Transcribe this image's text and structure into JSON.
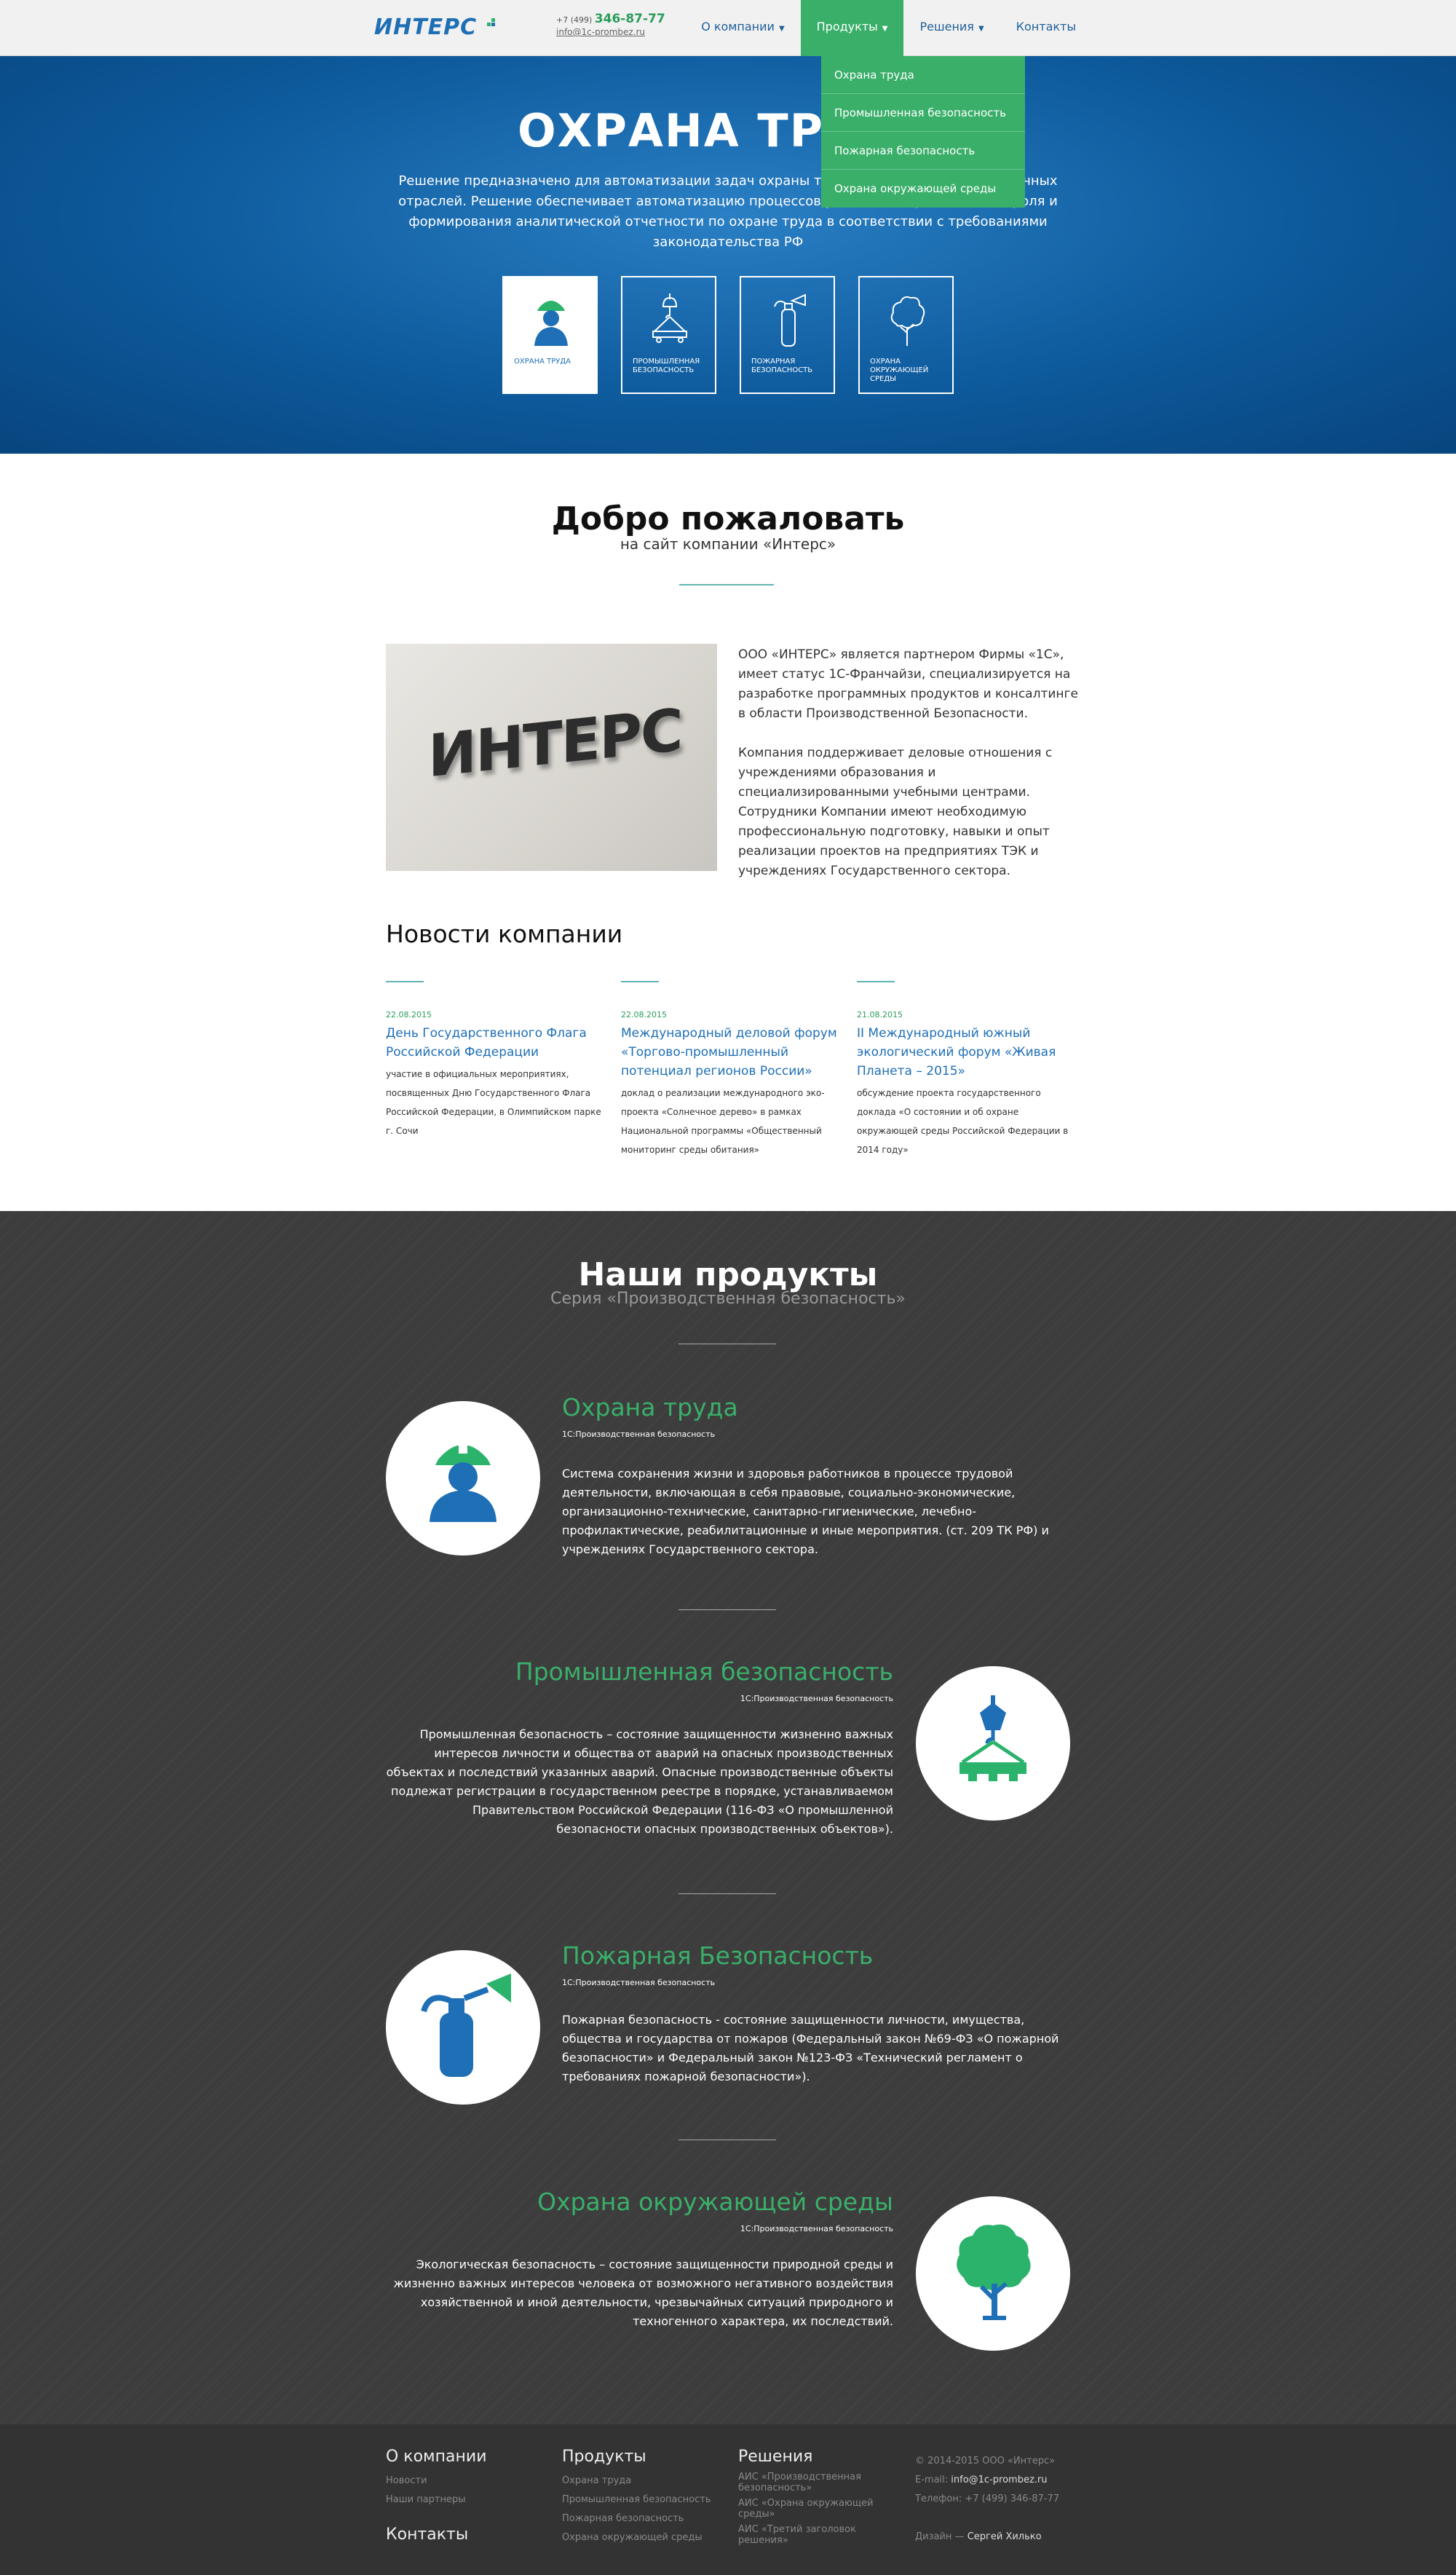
{
  "header": {
    "logo": "ИНТЕРС",
    "phone_prefix": "+7 (499)",
    "phone_number": "346-87-77",
    "email": "info@1c-prombez.ru",
    "nav": [
      "О компании",
      "Продукты",
      "Решения",
      "Контакты"
    ],
    "dropdown": [
      "Охрана труда",
      "Промышленная безопасность",
      "Пожарная безопасность",
      "Охрана окружающей среды"
    ]
  },
  "hero": {
    "title": "ОХРАНА ТРУДА",
    "description": "Решение предназначено для автоматизации задач охраны труда на предприятиях различных отраслей. Решение обеспечивает автоматизацию процессов учета, планирования, контроля и формирования аналитической отчетности по охране труда в соответствии с требованиями законодательства РФ",
    "tiles": [
      "Охрана труда",
      "Промышленная безопасность",
      "Пожарная безопасность",
      "Охрана окружающей среды"
    ]
  },
  "welcome": {
    "title": "Добро пожаловать",
    "subtitle": "на сайт компании «Интерс»",
    "sign": "ИНТЕРС",
    "p1": "ООО «ИНТЕРС» является партнером Фирмы «1С», имеет статус 1С-Франчайзи, специализируется на разработке программных продуктов и консалтинге в области Производственной Безопасности.",
    "p2": "Компания поддерживает деловые отношения с учреждениями образования и специализированными учебными центрами. Сотрудники Компании имеют необходимую профессиональную подготовку, навыки и опыт реализации проектов на предприятиях ТЭК и учреждениях Государственного сектора."
  },
  "news": {
    "title": "Новости компании",
    "items": [
      {
        "date": "22.08.2015",
        "title": "День Государственного Флага Российской Федерации",
        "text": "участие в официальных мероприятиях, посвященных Дню Государственного Флага Российской Федерации, в Олимпийском парке г. Сочи"
      },
      {
        "date": "22.08.2015",
        "title": "Международный деловой форум «Торгово-промышленный потенциал регионов России»",
        "text": "доклад о реализации международного эко-проекта «Солнечное дерево» в рамках Национальной программы «Общественный мониторинг среды обитания»"
      },
      {
        "date": "21.08.2015",
        "title": "II Международный южный экологический форум «Живая Планета – 2015»",
        "text": "обсуждение проекта государственного доклада «О состоянии и об охране окружающей среды Российской Федерации в 2014 году»"
      }
    ]
  },
  "products": {
    "title": "Наши продукты",
    "subtitle": "Серия «Производственная безопасность»",
    "tag": "1С:Производственная безопасность",
    "items": [
      {
        "title": "Охрана труда",
        "text": "Система сохранения жизни и здоровья работников в процессе трудовой деятельности, включающая в себя правовые, социально-экономические, организационно-технические, санитарно-гигиенические, лечебно-профилактические, реабилитационные и иные мероприятия. (ст. 209 ТК РФ) и учреждениях Государственного сектора."
      },
      {
        "title": "Промышленная безопасность",
        "text": "Промышленная безопасность – состояние защищенности жизненно важных интересов личности и общества от аварий на опасных производственных объектах и последствий указанных аварий. Опасные производственные объекты подлежат регистрации в государственном реестре в порядке, устанавливаемом Правительством Российской Федерации (116-ФЗ «О промышленной безопасности опасных производственных объектов»)."
      },
      {
        "title": "Пожарная Безопасность",
        "text": "Пожарная безопасность - состояние защищенности личности, имущества, общества и государства от пожаров (Федеральный закон №69-ФЗ «О пожарной безопасности» и Федеральный закон №123-ФЗ «Технический регламент о требованиях пожарной безопасности»)."
      },
      {
        "title": "Охрана окружающей среды",
        "text": "Экологическая безопасность – состояние защищенности природной среды и жизненно важных интересов человека от возможного негативного воздействия хозяйственной и иной деятельности, чрезвычайных ситуаций природного и техногенного характера, их последствий."
      }
    ]
  },
  "footer": {
    "about": "О компании",
    "about_links": [
      "Новости",
      "Наши партнеры"
    ],
    "contacts": "Контакты",
    "products": "Продукты",
    "product_links": [
      "Охрана труда",
      "Промышленная безопасность",
      "Пожарная безопасность",
      "Охрана окружающей среды"
    ],
    "solutions": "Решения",
    "solution_links": [
      "АИС «Производственная безопасность»",
      "АИС «Охрана окружающей среды»",
      "АИС «Третий заголовок решения»"
    ],
    "copyright": "© 2014-2015 ООО «Интерс»",
    "email_label": "E-mail:",
    "email": "info@1c-prombez.ru",
    "phone": "Телефон: +7 (499) 346-87-77",
    "design_label": "Дизайн —",
    "designer": "Сергей Хилько"
  },
  "colors": {
    "blue": "#0d5a9c",
    "green": "#3aaf6a",
    "dark": "#3d3d3d"
  }
}
